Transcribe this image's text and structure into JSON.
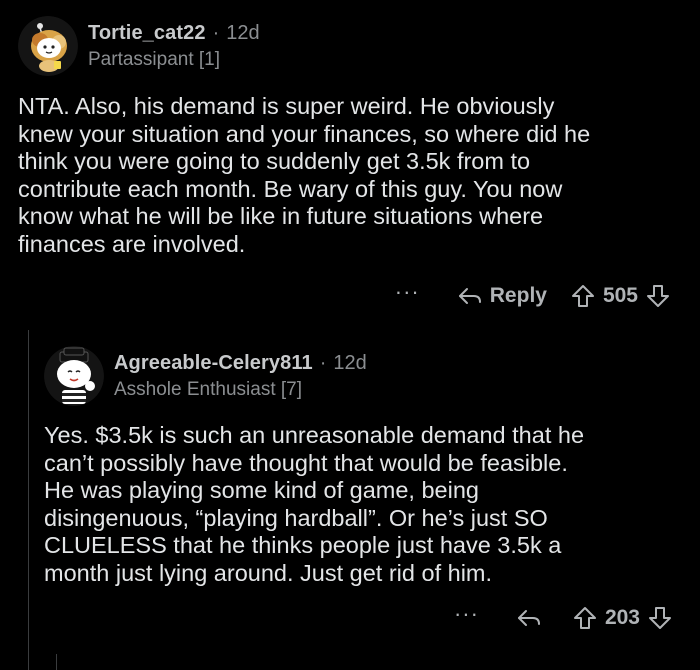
{
  "comments": [
    {
      "username": "Tortie_cat22",
      "separator": "·",
      "age": "12d",
      "flair": "Partassipant [1]",
      "body": "NTA. Also, his demand is super weird. He obviously\nknew your situation and your finances, so where did he\nthink you were going to suddenly get 3.5k from to\ncontribute each month. Be wary of this guy. You now\nknow what he will be like in future situations where\nfinances are involved.",
      "more_label": "···",
      "reply_label": "Reply",
      "score": "505"
    },
    {
      "username": "Agreeable-Celery811",
      "separator": "·",
      "age": "12d",
      "flair": "Asshole Enthusiast [7]",
      "body": "Yes. $3.5k is such an unreasonable demand that he\ncan’t possibly have thought that would be feasible.\nHe was playing some kind of game, being\ndisingenuous, “playing hardball”. Or he’s just SO\nCLUELESS that he thinks people just have 3.5k a\nmonth just lying around. Just get rid of him.",
      "more_label": "···",
      "score": "203"
    }
  ],
  "icons": {
    "avatar_1": "avatar-tortie-cat",
    "avatar_2": "avatar-mime-snoo",
    "reply": "reply-arrow-icon",
    "upvote": "upvote-arrow-icon",
    "downvote": "downvote-arrow-icon"
  },
  "colors": {
    "background": "#000000",
    "text": "#e3e5e7",
    "muted": "#8b8e91"
  }
}
